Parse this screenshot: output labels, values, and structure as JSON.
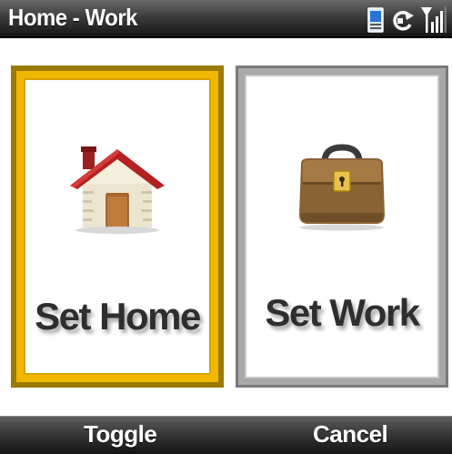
{
  "window": {
    "title": "Home - Work"
  },
  "status": {
    "icons": [
      "device-icon",
      "sync-icon",
      "signal-icon"
    ],
    "signal_level": 0.75
  },
  "cards": {
    "home": {
      "label": "Set Home",
      "icon": "house-icon",
      "selected": true,
      "accent": "#f2b800",
      "frame": "#9a7a00"
    },
    "work": {
      "label": "Set Work",
      "icon": "briefcase-icon",
      "selected": false,
      "accent": "#a8a8a8",
      "frame": "#7a7a7a"
    }
  },
  "softkeys": {
    "left_label": "Toggle",
    "right_label": "Cancel"
  }
}
